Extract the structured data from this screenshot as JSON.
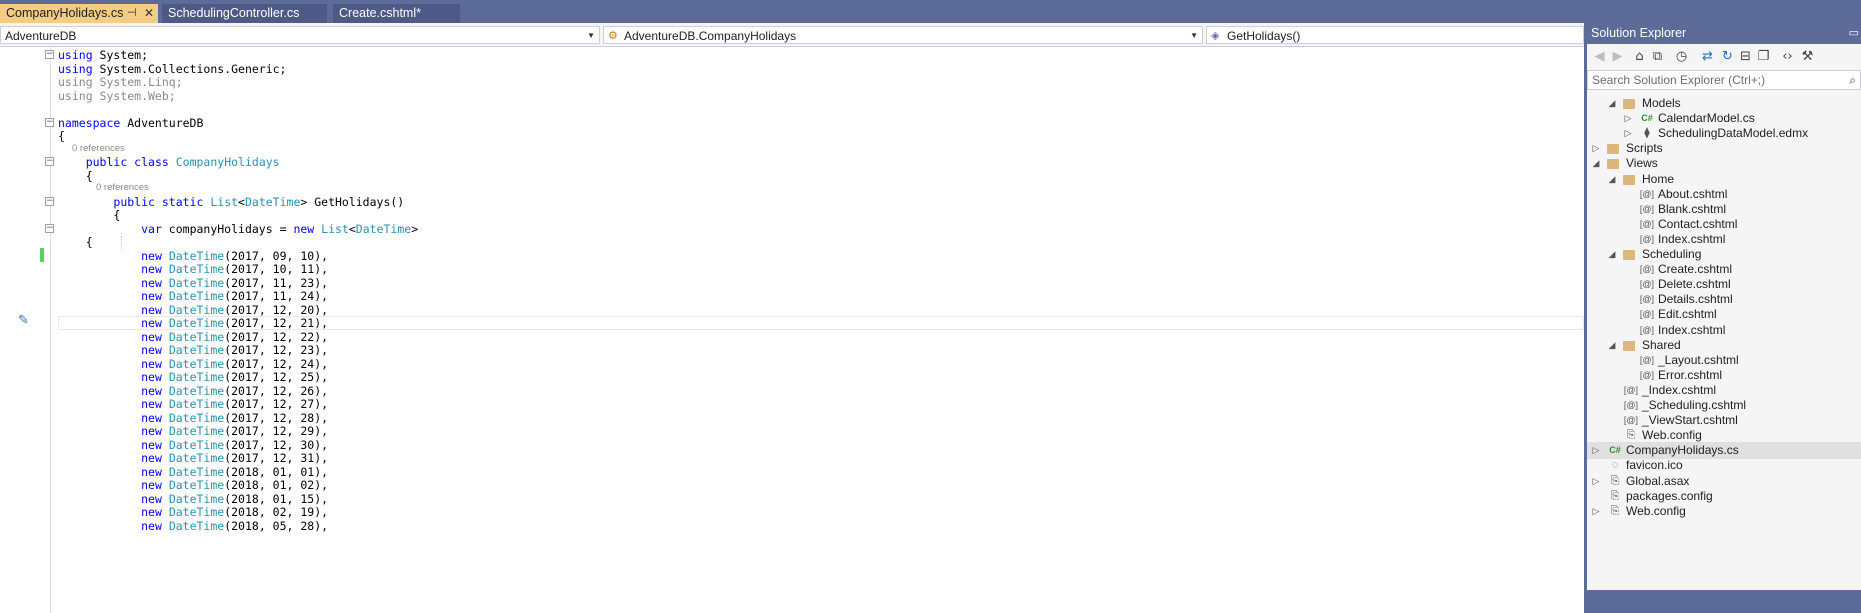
{
  "tabs": [
    {
      "label": "CompanyHolidays.cs",
      "active": true,
      "pin_glyph": "⊣",
      "close_glyph": "✕"
    },
    {
      "label": "SchedulingController.cs",
      "active": false
    },
    {
      "label": "Create.cshtml*",
      "active": false
    }
  ],
  "navbar": {
    "project": "AdventureDB",
    "type": "AdventureDB.CompanyHolidays",
    "member": "GetHolidays()"
  },
  "code": {
    "lens_top": "0 references",
    "lens_method": "0 references",
    "lines": [
      {
        "segments": [
          [
            "kw",
            "using"
          ],
          [
            "",
            " System;"
          ]
        ]
      },
      {
        "segments": [
          [
            "kw",
            "using"
          ],
          [
            "",
            " System.Collections.Generic;"
          ]
        ]
      },
      {
        "segments": [
          [
            "dim",
            "using System.Linq;"
          ]
        ]
      },
      {
        "segments": [
          [
            "dim",
            "using System.Web;"
          ]
        ]
      },
      {
        "segments": [
          [
            "",
            ""
          ]
        ]
      },
      {
        "segments": [
          [
            "kw",
            "namespace"
          ],
          [
            "",
            " AdventureDB"
          ]
        ]
      },
      {
        "segments": [
          [
            "",
            "{"
          ]
        ]
      },
      {
        "segments": [
          [
            "",
            "    "
          ],
          [
            "kw",
            "public class"
          ],
          [
            "",
            " "
          ],
          [
            "ty",
            "CompanyHolidays"
          ]
        ]
      },
      {
        "segments": [
          [
            "",
            "    {"
          ]
        ]
      },
      {
        "segments": [
          [
            "",
            "        "
          ],
          [
            "kw",
            "public static"
          ],
          [
            "",
            " "
          ],
          [
            "ty",
            "List"
          ],
          [
            "",
            "<"
          ],
          [
            "ty",
            "DateTime"
          ],
          [
            "",
            "> GetHolidays()"
          ]
        ]
      },
      {
        "segments": [
          [
            "",
            "        {"
          ]
        ]
      },
      {
        "segments": [
          [
            "",
            "            "
          ],
          [
            "kw",
            "var"
          ],
          [
            "",
            " companyHolidays = "
          ],
          [
            "kw",
            "new"
          ],
          [
            "",
            " "
          ],
          [
            "ty",
            "List"
          ],
          [
            "",
            "<"
          ],
          [
            "ty",
            "DateTime"
          ],
          [
            "",
            ">"
          ]
        ]
      },
      {
        "segments": [
          [
            "",
            "    {"
          ]
        ]
      },
      {
        "segments": [
          [
            "",
            ""
          ]
        ]
      }
    ],
    "dates": [
      "(2017, 09, 10),",
      "(2017, 10, 11),",
      "(2017, 11, 23),",
      "(2017, 11, 24),",
      "(2017, 12, 20),",
      "(2017, 12, 21),",
      "(2017, 12, 22),",
      "(2017, 12, 23),",
      "(2017, 12, 24),",
      "(2017, 12, 25),",
      "(2017, 12, 26),",
      "(2017, 12, 27),",
      "(2017, 12, 28),",
      "(2017, 12, 29),",
      "(2017, 12, 30),",
      "(2017, 12, 31),",
      "(2018, 01, 01),",
      "(2018, 01, 02),",
      "(2018, 01, 15),",
      "(2018, 02, 19),",
      "(2018, 05, 28),"
    ],
    "new_kw": "new",
    "datetime_type": "DateTime",
    "colors": {
      "keyword": "#0000ff",
      "type": "#2b91af",
      "comment_dim": "#8a8a8a",
      "change_bar": "#57d15d"
    }
  },
  "solution_explorer": {
    "title": "Solution Explorer",
    "search_placeholder": "Search Solution Explorer (Ctrl+;)",
    "toolbar_icons": [
      "back-icon",
      "forward-icon",
      "home-icon",
      "switch-views-icon",
      "history-icon",
      "sync-icon",
      "refresh-icon",
      "collapse-all-icon",
      "show-all-files-icon",
      "view-code-icon",
      "properties-icon"
    ],
    "tree": [
      {
        "label": "Models",
        "icon": "folder-open",
        "indent": 1,
        "expander": "◢"
      },
      {
        "label": "CalendarModel.cs",
        "icon": "cs-file",
        "indent": 2,
        "expander": "▷"
      },
      {
        "label": "SchedulingDataModel.edmx",
        "icon": "edmx-file",
        "indent": 2,
        "expander": "▷"
      },
      {
        "label": "Scripts",
        "icon": "folder",
        "indent": 0,
        "expander": "▷"
      },
      {
        "label": "Views",
        "icon": "folder-open",
        "indent": 0,
        "expander": "◢"
      },
      {
        "label": "Home",
        "icon": "folder-open",
        "indent": 1,
        "expander": "◢"
      },
      {
        "label": "About.cshtml",
        "icon": "razor-file",
        "indent": 2,
        "expander": ""
      },
      {
        "label": "Blank.cshtml",
        "icon": "razor-file",
        "indent": 2,
        "expander": ""
      },
      {
        "label": "Contact.cshtml",
        "icon": "razor-file",
        "indent": 2,
        "expander": ""
      },
      {
        "label": "Index.cshtml",
        "icon": "razor-file",
        "indent": 2,
        "expander": ""
      },
      {
        "label": "Scheduling",
        "icon": "folder-open",
        "indent": 1,
        "expander": "◢"
      },
      {
        "label": "Create.cshtml",
        "icon": "razor-file",
        "indent": 2,
        "expander": ""
      },
      {
        "label": "Delete.cshtml",
        "icon": "razor-file",
        "indent": 2,
        "expander": ""
      },
      {
        "label": "Details.cshtml",
        "icon": "razor-file",
        "indent": 2,
        "expander": ""
      },
      {
        "label": "Edit.cshtml",
        "icon": "razor-file",
        "indent": 2,
        "expander": ""
      },
      {
        "label": "Index.cshtml",
        "icon": "razor-file",
        "indent": 2,
        "expander": ""
      },
      {
        "label": "Shared",
        "icon": "folder-open",
        "indent": 1,
        "expander": "◢"
      },
      {
        "label": "_Layout.cshtml",
        "icon": "razor-file",
        "indent": 2,
        "expander": ""
      },
      {
        "label": "Error.cshtml",
        "icon": "razor-file",
        "indent": 2,
        "expander": ""
      },
      {
        "label": "_Index.cshtml",
        "icon": "razor-file",
        "indent": 1,
        "expander": ""
      },
      {
        "label": "_Scheduling.cshtml",
        "icon": "razor-file",
        "indent": 1,
        "expander": ""
      },
      {
        "label": "_ViewStart.cshtml",
        "icon": "razor-file",
        "indent": 1,
        "expander": ""
      },
      {
        "label": "Web.config",
        "icon": "config-file",
        "indent": 1,
        "expander": ""
      },
      {
        "label": "CompanyHolidays.cs",
        "icon": "cs-file",
        "indent": 0,
        "expander": "▷",
        "selected": true
      },
      {
        "label": "favicon.ico",
        "icon": "image-file",
        "indent": 0,
        "expander": ""
      },
      {
        "label": "Global.asax",
        "icon": "config-file",
        "indent": 0,
        "expander": "▷"
      },
      {
        "label": "packages.config",
        "icon": "config-file",
        "indent": 0,
        "expander": ""
      },
      {
        "label": "Web.config",
        "icon": "config-file",
        "indent": 0,
        "expander": "▷"
      }
    ]
  }
}
